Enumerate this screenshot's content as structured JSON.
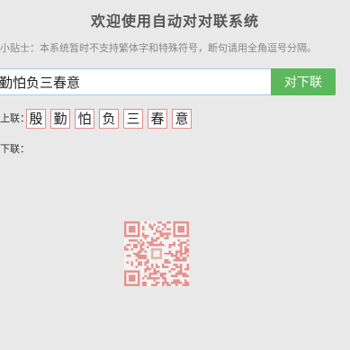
{
  "header": {
    "title": "欢迎使用自动对对联系统"
  },
  "tip": {
    "text": "小贴士：本系统暂时不支持繁体字和特殊符号，断句请用全角逗号分隔。"
  },
  "input": {
    "value": "勤怕负三春意",
    "button_label": "对下联"
  },
  "upper": {
    "label": "上联：",
    "chars": [
      "殷",
      "勤",
      "怕",
      "负",
      "三",
      "春",
      "意"
    ]
  },
  "lower": {
    "label": "下联："
  },
  "colors": {
    "accent": "#5cb85c",
    "char_border": "#e08c8c",
    "qr": "#e6928f"
  }
}
